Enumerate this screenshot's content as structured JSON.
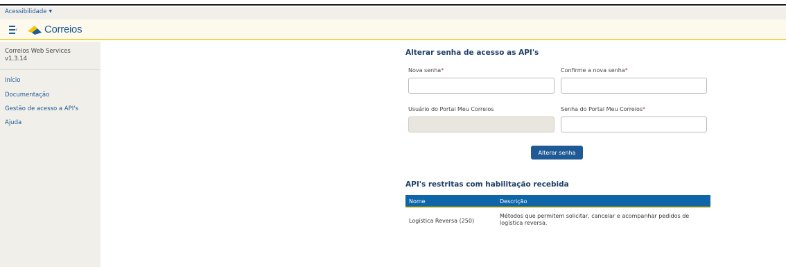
{
  "accessibility": {
    "label": "Acessibilidade",
    "caret": "▼"
  },
  "header": {
    "logo_text": "Correios"
  },
  "sidebar": {
    "version_title": "Correios Web Services",
    "version": "v1.3.14",
    "items": [
      {
        "label": "Início"
      },
      {
        "label": "Documentação"
      },
      {
        "label": "Gestão de acesso a API's"
      },
      {
        "label": "Ajuda"
      }
    ]
  },
  "form": {
    "title": "Alterar senha de acesso as API's",
    "new_password_label": "Nova senha",
    "confirm_password_label": "Confirme a nova senha",
    "portal_user_label": "Usuário do Portal Meu Correios",
    "portal_password_label": "Senha do Portal Meu Correios",
    "required_mark": "*",
    "submit_label": "Alterar senha"
  },
  "restricted": {
    "title": "API's restritas com habilitação recebida",
    "columns": [
      "Nome",
      "Descrição"
    ],
    "rows": [
      {
        "name": "Logística Reversa (250)",
        "description_line1": "Métodos que permitem solicitar, cancelar e acompanhar pedidos de",
        "description_line2": "logística reversa."
      }
    ]
  },
  "colors": {
    "brand_blue": "#1f5a96",
    "table_header": "#0e65a8",
    "brand_yellow": "#f5d547",
    "sidebar_bg": "#f1efea"
  }
}
